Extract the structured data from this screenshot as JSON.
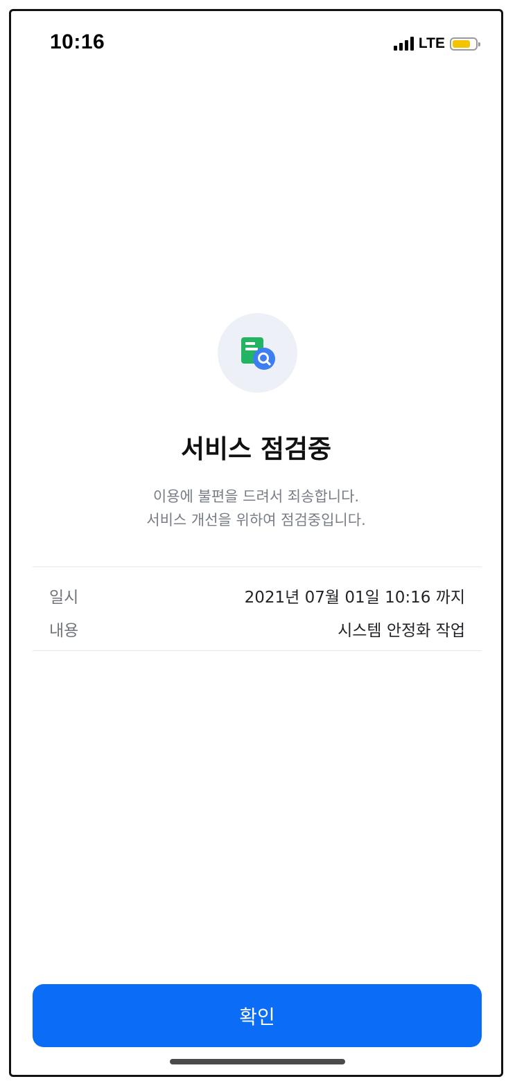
{
  "status_bar": {
    "time": "10:16",
    "network": "LTE",
    "signal_icon": "signal-bars-icon",
    "battery_icon": "battery-icon",
    "battery_color": "#f5c400"
  },
  "maintenance": {
    "icon": "document-search-icon",
    "title": "서비스 점검중",
    "description_line1": "이용에 불편을 드려서 죄송합니다.",
    "description_line2": "서비스 개선을 위하여 점검중입니다."
  },
  "info": {
    "rows": [
      {
        "label": "일시",
        "value": "2021년 07월 01일 10:16 까지"
      },
      {
        "label": "내용",
        "value": "시스템 안정화 작업"
      }
    ]
  },
  "confirm_button": {
    "label": "확인",
    "color": "#0b6cf5"
  }
}
